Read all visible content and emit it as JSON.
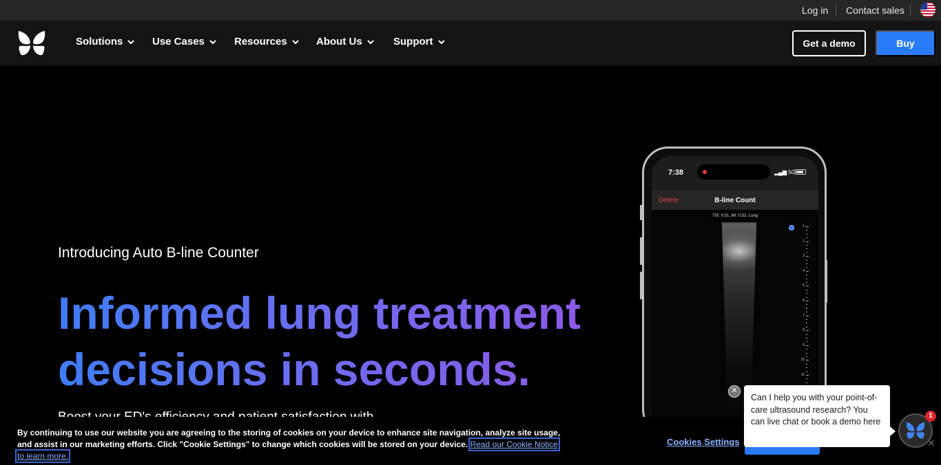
{
  "utility": {
    "login": "Log in",
    "contact_sales": "Contact sales",
    "flag_icon": "us-flag-icon"
  },
  "nav": {
    "items": [
      {
        "label": "Solutions"
      },
      {
        "label": "Use Cases"
      },
      {
        "label": "Resources"
      },
      {
        "label": "About Us"
      },
      {
        "label": "Support"
      }
    ],
    "demo_button": "Get a demo",
    "buy_button": "Buy"
  },
  "hero": {
    "eyebrow": "Introducing Auto B-line Counter",
    "headline_line1": "Informed lung treatment",
    "headline_line2": "decisions in seconds.",
    "subtext": "Boost your ED's efficiency and patient satisfaction with"
  },
  "phone": {
    "time": "7:38",
    "signal": "5G",
    "delete_label": "Delete",
    "screen_title": "B-line Count",
    "scan_info": "TIS: 0.01, MI: 0.52, Lung",
    "marker_label": "B",
    "ruler_ticks": [
      "1",
      "2",
      "3",
      "4",
      "5",
      "6",
      "7",
      "8",
      "9",
      "10",
      "11"
    ]
  },
  "cookie": {
    "text": "By continuing to use our website you are agreeing to the storing of cookies on your device to enhance site navigation, analyze site usage, and assist in our marketing efforts. Click \"Cookie Settings\" to change which cookies will be stored on your device.",
    "notice_link": "Read our Cookie Notice to learn more.",
    "settings_label": "Cookies Settings",
    "close_label": "✕"
  },
  "chat": {
    "message": "Can I help you with your point-of-care ultrasound research? You can live chat or book a demo here",
    "badge_count": "1",
    "close_label": "✕"
  },
  "colors": {
    "accent_blue": "#2a7cf6",
    "headline_gradient_start": "#3f7df7",
    "headline_gradient_end": "#8b5be6",
    "nav_bg": "#141414",
    "utility_bg": "#262626"
  }
}
